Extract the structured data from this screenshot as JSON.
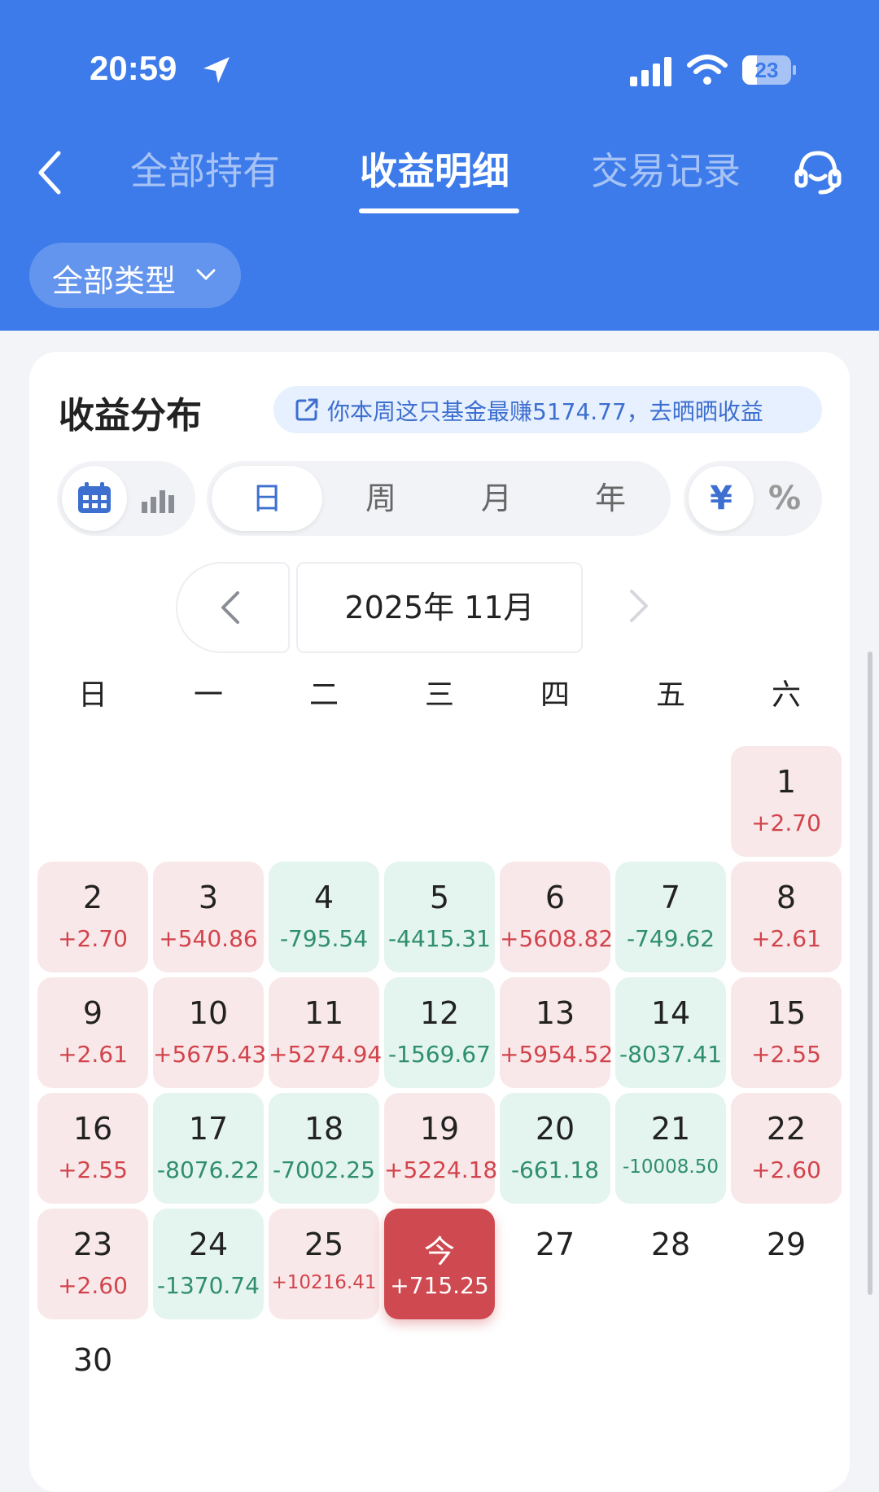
{
  "status_bar": {
    "time": "20:59",
    "battery": "23"
  },
  "nav": {
    "tabs": [
      {
        "label": "全部持有"
      },
      {
        "label": "收益明细"
      },
      {
        "label": "交易记录"
      }
    ]
  },
  "filter": {
    "label": "全部类型"
  },
  "card": {
    "title": "收益分布",
    "share_text": "你本周这只基金最赚5174.77，去晒晒收益",
    "periods": [
      "日",
      "周",
      "月",
      "年"
    ],
    "units": [
      "¥",
      "%"
    ],
    "month_label": "2025年 11月",
    "weekdays": [
      "日",
      "一",
      "二",
      "三",
      "四",
      "五",
      "六"
    ],
    "days": [
      {
        "day": "1",
        "value": "+2.70",
        "type": "gain"
      },
      {
        "day": "2",
        "value": "+2.70",
        "type": "gain"
      },
      {
        "day": "3",
        "value": "+540.86",
        "type": "gain"
      },
      {
        "day": "4",
        "value": "-795.54",
        "type": "loss"
      },
      {
        "day": "5",
        "value": "-4415.31",
        "type": "loss"
      },
      {
        "day": "6",
        "value": "+5608.82",
        "type": "gain"
      },
      {
        "day": "7",
        "value": "-749.62",
        "type": "loss"
      },
      {
        "day": "8",
        "value": "+2.61",
        "type": "gain"
      },
      {
        "day": "9",
        "value": "+2.61",
        "type": "gain"
      },
      {
        "day": "10",
        "value": "+5675.43",
        "type": "gain"
      },
      {
        "day": "11",
        "value": "+5274.94",
        "type": "gain"
      },
      {
        "day": "12",
        "value": "-1569.67",
        "type": "loss"
      },
      {
        "day": "13",
        "value": "+5954.52",
        "type": "gain"
      },
      {
        "day": "14",
        "value": "-8037.41",
        "type": "loss"
      },
      {
        "day": "15",
        "value": "+2.55",
        "type": "gain"
      },
      {
        "day": "16",
        "value": "+2.55",
        "type": "gain"
      },
      {
        "day": "17",
        "value": "-8076.22",
        "type": "loss"
      },
      {
        "day": "18",
        "value": "-7002.25",
        "type": "loss"
      },
      {
        "day": "19",
        "value": "+5224.18",
        "type": "gain"
      },
      {
        "day": "20",
        "value": "-661.18",
        "type": "loss"
      },
      {
        "day": "21",
        "value": "-10008.50",
        "type": "loss"
      },
      {
        "day": "22",
        "value": "+2.60",
        "type": "gain"
      },
      {
        "day": "23",
        "value": "+2.60",
        "type": "gain"
      },
      {
        "day": "24",
        "value": "-1370.74",
        "type": "loss"
      },
      {
        "day": "25",
        "value": "+10216.41",
        "type": "gain"
      },
      {
        "day": "今",
        "value": "+715.25",
        "type": "today"
      },
      {
        "day": "27",
        "value": "",
        "type": "future"
      },
      {
        "day": "28",
        "value": "",
        "type": "future"
      },
      {
        "day": "29",
        "value": "",
        "type": "future"
      },
      {
        "day": "30",
        "value": "",
        "type": "future"
      }
    ]
  },
  "colors": {
    "header": "#3d7bea",
    "gain_text": "#d2444c",
    "loss_text": "#2f8f6c",
    "today_bg": "#cf4a50"
  }
}
